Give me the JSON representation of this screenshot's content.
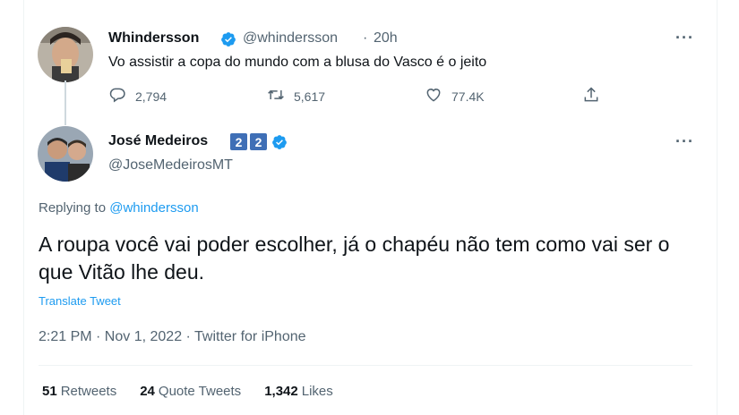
{
  "original_tweet": {
    "name": "Whindersson",
    "handle": "@whindersson",
    "separator": "·",
    "time": "20h",
    "text": "Vo assistir a copa do mundo com a blusa do Vasco é o jeito",
    "replies": "2,794",
    "retweets": "5,617",
    "likes": "77.4K",
    "more": "···"
  },
  "reply_tweet": {
    "name": "José Medeiros",
    "badges": [
      "2",
      "2"
    ],
    "handle": "@JoseMedeirosMT",
    "more": "···",
    "replying_prefix": "Replying to",
    "replying_handle": "@whindersson",
    "text": "A roupa você vai poder escolher, já o chapéu não tem como vai ser o que Vitão lhe deu.",
    "translate_label": "Translate Tweet",
    "meta": "2:21 PM · Nov 1, 2022 · Twitter for iPhone",
    "stats": {
      "retweets_count": "51",
      "retweets_label": "Retweets",
      "quotes_count": "24",
      "quotes_label": "Quote Tweets",
      "likes_count": "1,342",
      "likes_label": "Likes"
    }
  },
  "colors": {
    "accent": "#1d9bf0",
    "secondary_text": "#536471",
    "badge_blue": "#3f6fb6"
  }
}
